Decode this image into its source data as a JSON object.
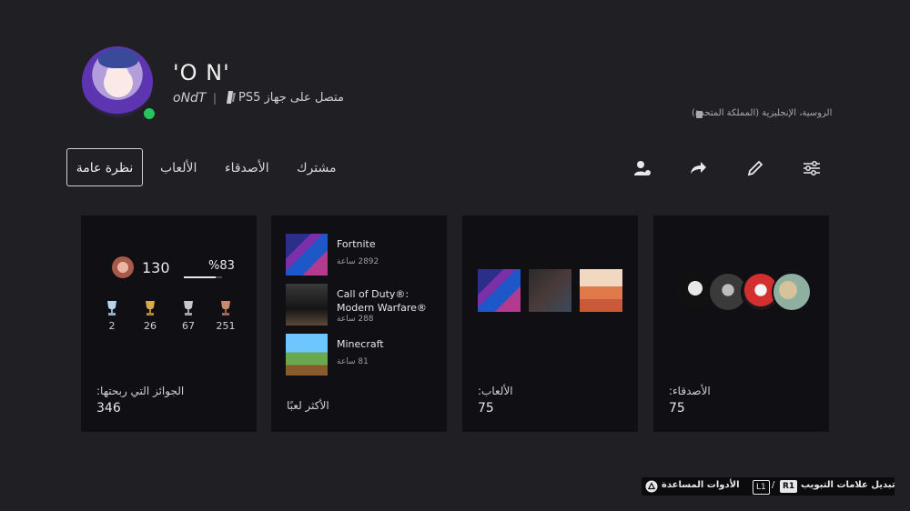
{
  "profile": {
    "name": "'O N'",
    "online_id": "oNdT",
    "separator": "|",
    "platform_label": "PS5",
    "status_text": "متصل على جهاز",
    "languages": "الروسية، الإنجليزية (المملكة المتحدة)"
  },
  "tabs": {
    "overview": "نظرة عامة",
    "games": "الألعاب",
    "friends": "الأصدقاء",
    "shared": "مشترك"
  },
  "icons": {
    "add_friend": "add-friend-icon",
    "share": "share-icon",
    "edit": "edit-icon",
    "settings": "settings-sliders-icon"
  },
  "trophies": {
    "level": "130",
    "progress_text": "%83",
    "progress_fraction": 0.83,
    "platinum": "2",
    "gold": "26",
    "silver": "67",
    "bronze": "251",
    "label": "الجوائز التي ربحتها:",
    "total": "346"
  },
  "most_played": {
    "label": "الأكثر لعبًا",
    "items": [
      {
        "title": "Fortnite",
        "hours": "2892 ساعة"
      },
      {
        "title": "Call of Duty®: Modern Warfare®",
        "hours": "288 ساعة"
      },
      {
        "title": "Minecraft",
        "hours": "81 ساعة"
      }
    ]
  },
  "games_card": {
    "label": "الألعاب:",
    "count": "75"
  },
  "friends_card": {
    "label": "الأصدقاء:",
    "count": "75"
  },
  "footer": {
    "tab_switch": "تبديل علامات التبويب",
    "r1": "R1",
    "slash": "/",
    "l1": "L1",
    "accessibility": "الأدوات المساعدة"
  },
  "colors": {
    "background": "#1f1f24",
    "card": "#101014",
    "online": "#22c55e"
  }
}
